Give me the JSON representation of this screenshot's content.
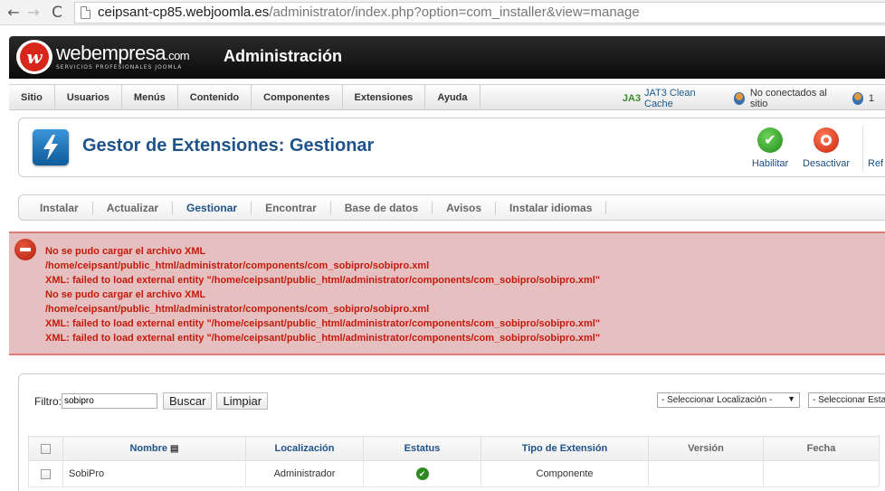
{
  "browser": {
    "back_icon": "←",
    "forward_icon": "→",
    "reload_icon": "C",
    "url_host": "ceipsant-cp85.webjoomla.es",
    "url_rest": "/administrator/index.php?option=com_installer&view=manage"
  },
  "header": {
    "logo_letter": "w",
    "brand_name": "webempresa",
    "brand_suffix": ".com",
    "tagline": "SERVICIOS PROFESIONALES JOOMLA",
    "admin_title": "Administración"
  },
  "menu": {
    "items": [
      "Sitio",
      "Usuarios",
      "Menús",
      "Contenido",
      "Componentes",
      "Extensiones",
      "Ayuda"
    ],
    "cache_icon": "JA3",
    "cache_link": "JAT3 Clean Cache",
    "users_status": "No conectados al sitio",
    "admins_count": "1"
  },
  "toolbar": {
    "title": "Gestor de Extensiones: Gestionar",
    "enable_label": "Habilitar",
    "disable_label": "Desactivar",
    "refresh_label": "Ref"
  },
  "subtabs": [
    "Instalar",
    "Actualizar",
    "Gestionar",
    "Encontrar",
    "Base de datos",
    "Avisos",
    "Instalar idiomas"
  ],
  "errors": [
    "No se pudo cargar el archivo XML",
    "/home/ceipsant/public_html/administrator/components/com_sobipro/sobipro.xml",
    "XML: failed to load external entity \"/home/ceipsant/public_html/administrator/components/com_sobipro/sobipro.xml\"",
    "No se pudo cargar el archivo XML",
    "/home/ceipsant/public_html/administrator/components/com_sobipro/sobipro.xml",
    "XML: failed to load external entity \"/home/ceipsant/public_html/administrator/components/com_sobipro/sobipro.xml\"",
    "XML: failed to load external entity \"/home/ceipsant/public_html/administrator/components/com_sobipro/sobipro.xml\""
  ],
  "filter": {
    "label": "Filtro:",
    "value": "sobipro",
    "search_button": "Buscar",
    "clear_button": "Limpiar",
    "location_select": "- Seleccionar Localización -",
    "status_select": "- Seleccionar Esta"
  },
  "table": {
    "headers": {
      "name": "Nombre",
      "location": "Localización",
      "status": "Estatus",
      "type": "Tipo de Extensión",
      "version": "Versión",
      "date": "Fecha"
    },
    "rows": [
      {
        "name": "SobiPro",
        "location": "Administrador",
        "status": "enabled",
        "type": "Componente",
        "version": "",
        "date": ""
      }
    ]
  }
}
